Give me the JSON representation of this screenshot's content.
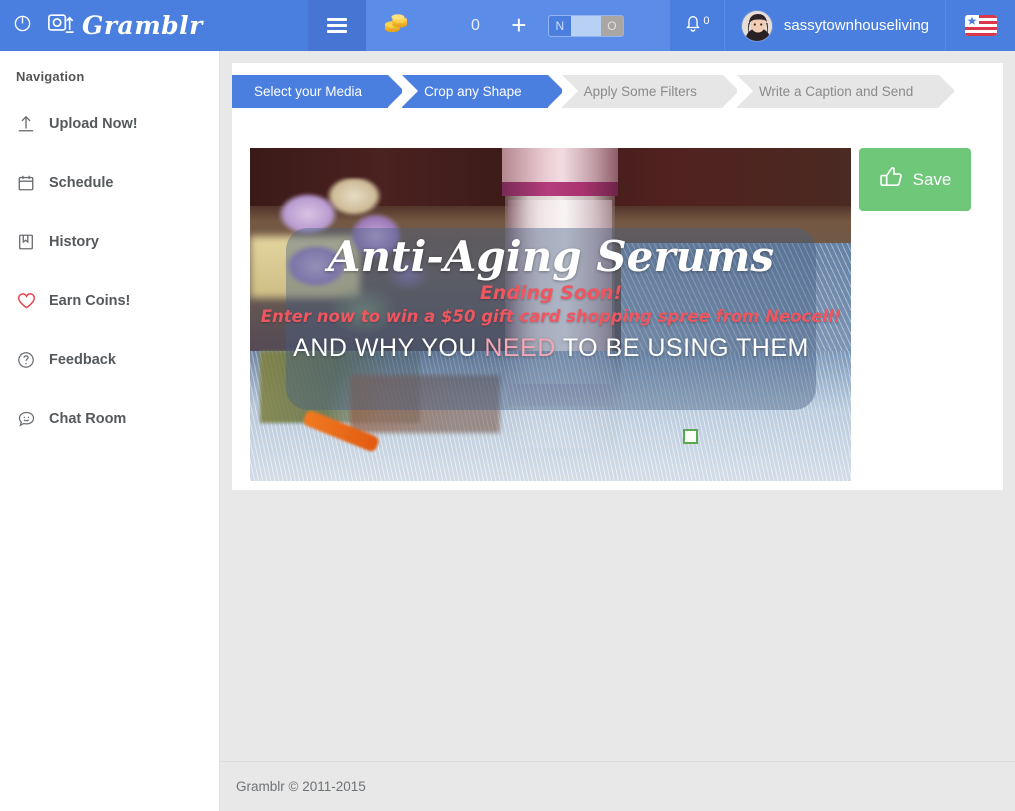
{
  "header": {
    "power_icon": "power-icon",
    "logo_icon": "camera-upload-icon",
    "brand": "Gramblr",
    "menu_icon": "hamburger-menu-icon",
    "coin_icon": "coin-stack-icon",
    "coin_count": "0",
    "add_label": "+",
    "toggle": {
      "on_label": "N",
      "off_label": "O"
    },
    "bell_icon": "bell-icon",
    "bell_badge": "0",
    "avatar_name": "avatar",
    "username": "sassytownhouseliving",
    "flag_icon": "us-flag-icon"
  },
  "sidebar": {
    "title": "Navigation",
    "items": [
      {
        "label": "Upload Now!",
        "icon": "upload-icon"
      },
      {
        "label": "Schedule",
        "icon": "calendar-icon"
      },
      {
        "label": "History",
        "icon": "bookmark-icon"
      },
      {
        "label": "Earn Coins!",
        "icon": "heart-icon"
      },
      {
        "label": "Feedback",
        "icon": "question-circle-icon"
      },
      {
        "label": "Chat Room",
        "icon": "chat-bubble-icon"
      }
    ]
  },
  "steps": [
    {
      "label": "Select your Media",
      "state": "active"
    },
    {
      "label": "Crop any Shape",
      "state": "active"
    },
    {
      "label": "Apply Some Filters",
      "state": "inactive"
    },
    {
      "label": "Write a Caption and Send",
      "state": "inactive"
    }
  ],
  "editor": {
    "image": {
      "title": "Anti-Aging Serums",
      "ending": "Ending Soon!",
      "promo": "Enter now to win a $50 gift card shopping spree from Neocell!",
      "subtitle_before": "AND WHY YOU ",
      "subtitle_highlight": "NEED",
      "subtitle_after": " TO BE USING THEM"
    },
    "save_label": "Save",
    "save_icon": "thumbs-up-icon",
    "crop_handle": "crop-handle"
  },
  "footer": {
    "copyright": "Gramblr © 2011-2015"
  },
  "colors": {
    "header_blue": "#4a7fe0",
    "header_blue_light": "#5b8ce8",
    "step_active": "#4a7fe0",
    "step_inactive": "#e6e6e6",
    "save_green": "#6fc77a",
    "accent_red": "#e8434f",
    "promo_red": "#f0565f"
  }
}
